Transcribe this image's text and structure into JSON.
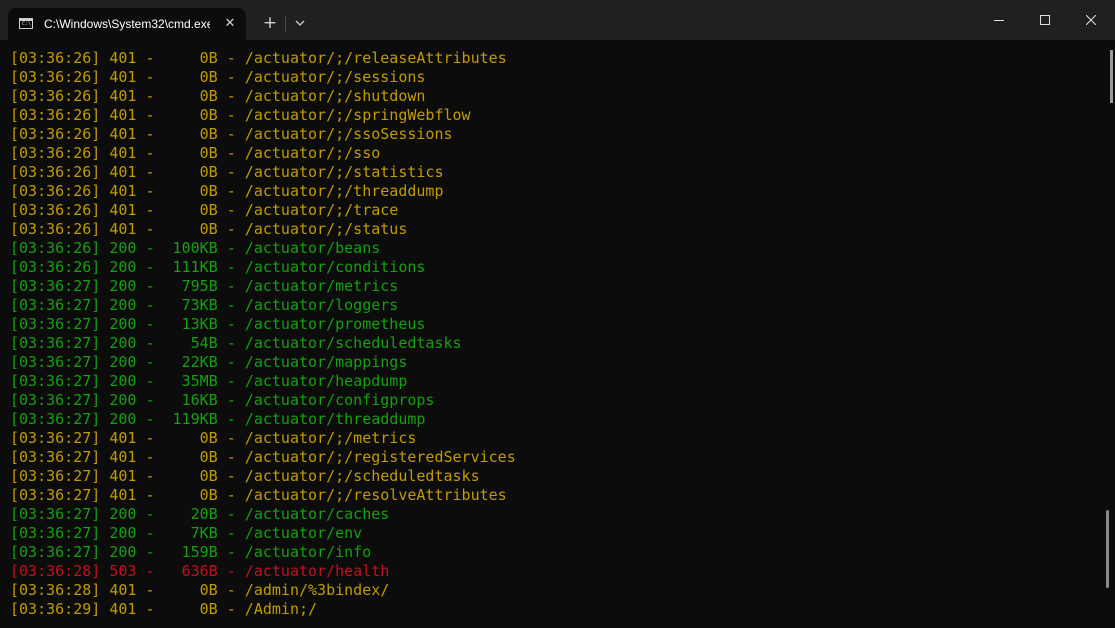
{
  "window": {
    "tab_title": "C:\\Windows\\System32\\cmd.exe",
    "tab_icon": "console-icon",
    "close_tab_glyph": "✕",
    "new_tab_glyph": "+",
    "dropdown_icon": "chevron-down-icon",
    "controls": [
      "minimize-icon",
      "maximize-icon",
      "close-icon"
    ]
  },
  "colors": {
    "yellow": "#c19c00",
    "green": "#13a10e",
    "red": "#c50f1f",
    "background": "#0c0c0c"
  },
  "lines": [
    {
      "time": "[03:36:26]",
      "status": "401",
      "size": "0B",
      "path": "/actuator/;/releaseAttributes",
      "color": "yellow"
    },
    {
      "time": "[03:36:26]",
      "status": "401",
      "size": "0B",
      "path": "/actuator/;/sessions",
      "color": "yellow"
    },
    {
      "time": "[03:36:26]",
      "status": "401",
      "size": "0B",
      "path": "/actuator/;/shutdown",
      "color": "yellow"
    },
    {
      "time": "[03:36:26]",
      "status": "401",
      "size": "0B",
      "path": "/actuator/;/springWebflow",
      "color": "yellow"
    },
    {
      "time": "[03:36:26]",
      "status": "401",
      "size": "0B",
      "path": "/actuator/;/ssoSessions",
      "color": "yellow"
    },
    {
      "time": "[03:36:26]",
      "status": "401",
      "size": "0B",
      "path": "/actuator/;/sso",
      "color": "yellow"
    },
    {
      "time": "[03:36:26]",
      "status": "401",
      "size": "0B",
      "path": "/actuator/;/statistics",
      "color": "yellow"
    },
    {
      "time": "[03:36:26]",
      "status": "401",
      "size": "0B",
      "path": "/actuator/;/threaddump",
      "color": "yellow"
    },
    {
      "time": "[03:36:26]",
      "status": "401",
      "size": "0B",
      "path": "/actuator/;/trace",
      "color": "yellow"
    },
    {
      "time": "[03:36:26]",
      "status": "401",
      "size": "0B",
      "path": "/actuator/;/status",
      "color": "yellow"
    },
    {
      "time": "[03:36:26]",
      "status": "200",
      "size": "100KB",
      "path": "/actuator/beans",
      "color": "green"
    },
    {
      "time": "[03:36:26]",
      "status": "200",
      "size": "111KB",
      "path": "/actuator/conditions",
      "color": "green"
    },
    {
      "time": "[03:36:27]",
      "status": "200",
      "size": "795B",
      "path": "/actuator/metrics",
      "color": "green"
    },
    {
      "time": "[03:36:27]",
      "status": "200",
      "size": "73KB",
      "path": "/actuator/loggers",
      "color": "green"
    },
    {
      "time": "[03:36:27]",
      "status": "200",
      "size": "13KB",
      "path": "/actuator/prometheus",
      "color": "green"
    },
    {
      "time": "[03:36:27]",
      "status": "200",
      "size": "54B",
      "path": "/actuator/scheduledtasks",
      "color": "green"
    },
    {
      "time": "[03:36:27]",
      "status": "200",
      "size": "22KB",
      "path": "/actuator/mappings",
      "color": "green"
    },
    {
      "time": "[03:36:27]",
      "status": "200",
      "size": "35MB",
      "path": "/actuator/heapdump",
      "color": "green"
    },
    {
      "time": "[03:36:27]",
      "status": "200",
      "size": "16KB",
      "path": "/actuator/configprops",
      "color": "green"
    },
    {
      "time": "[03:36:27]",
      "status": "200",
      "size": "119KB",
      "path": "/actuator/threaddump",
      "color": "green"
    },
    {
      "time": "[03:36:27]",
      "status": "401",
      "size": "0B",
      "path": "/actuator/;/metrics",
      "color": "yellow"
    },
    {
      "time": "[03:36:27]",
      "status": "401",
      "size": "0B",
      "path": "/actuator/;/registeredServices",
      "color": "yellow"
    },
    {
      "time": "[03:36:27]",
      "status": "401",
      "size": "0B",
      "path": "/actuator/;/scheduledtasks",
      "color": "yellow"
    },
    {
      "time": "[03:36:27]",
      "status": "401",
      "size": "0B",
      "path": "/actuator/;/resolveAttributes",
      "color": "yellow"
    },
    {
      "time": "[03:36:27]",
      "status": "200",
      "size": "20B",
      "path": "/actuator/caches",
      "color": "green"
    },
    {
      "time": "[03:36:27]",
      "status": "200",
      "size": "7KB",
      "path": "/actuator/env",
      "color": "green"
    },
    {
      "time": "[03:36:27]",
      "status": "200",
      "size": "159B",
      "path": "/actuator/info",
      "color": "green"
    },
    {
      "time": "[03:36:28]",
      "status": "503",
      "size": "636B",
      "path": "/actuator/health",
      "color": "red"
    },
    {
      "time": "[03:36:28]",
      "status": "401",
      "size": "0B",
      "path": "/admin/%3bindex/",
      "color": "yellow"
    },
    {
      "time": "[03:36:29]",
      "status": "401",
      "size": "0B",
      "path": "/Admin;/",
      "color": "yellow"
    }
  ]
}
